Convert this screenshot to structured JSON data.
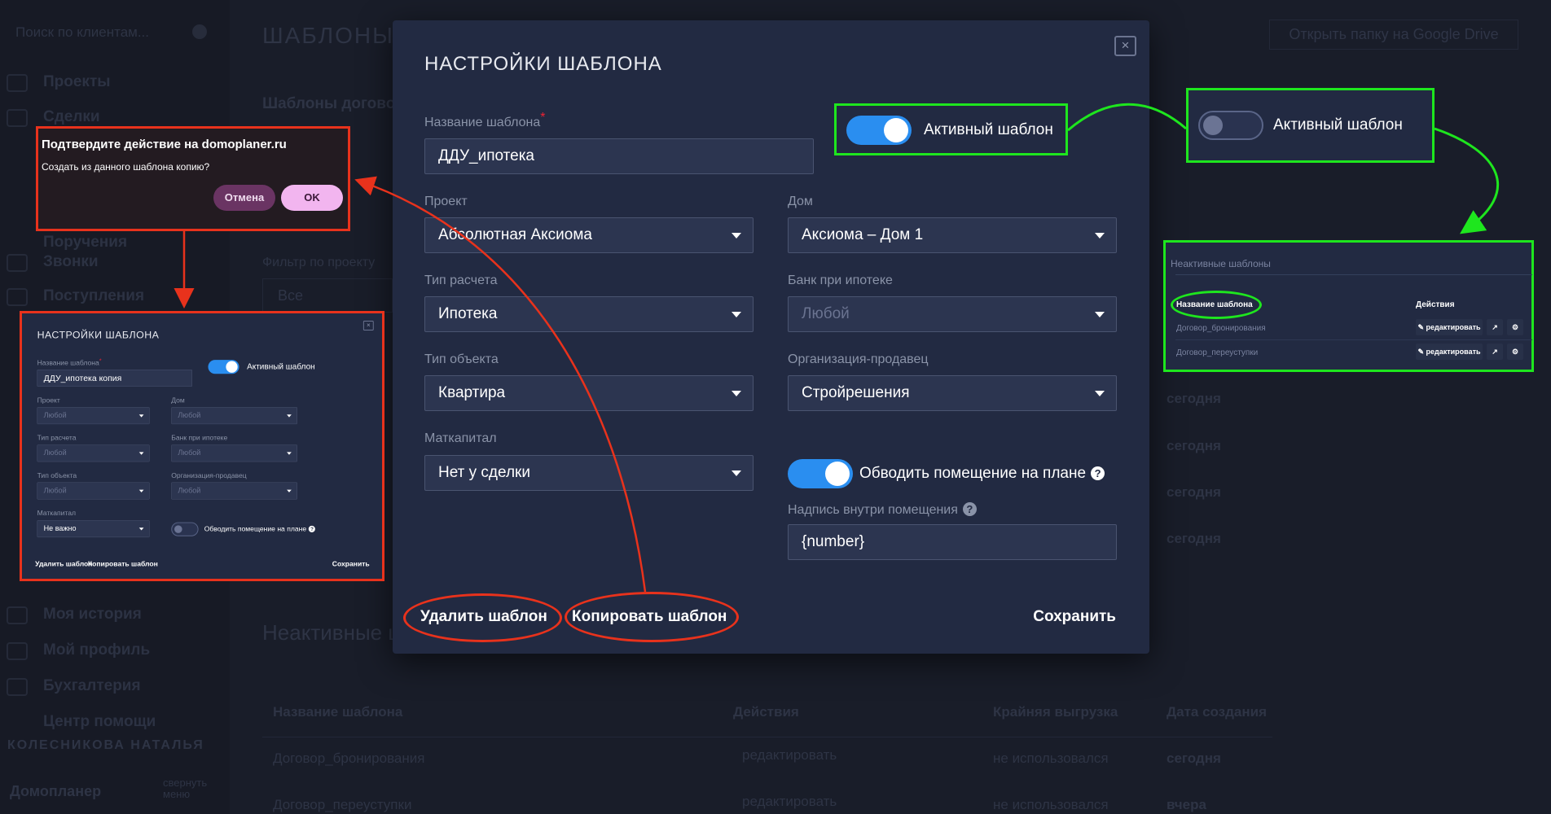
{
  "background": {
    "search_placeholder": "Поиск по клиентам...",
    "sidebar_items": [
      "Проекты",
      "Сделки",
      "Поручения",
      "Звонки",
      "Поступления",
      "Моя история",
      "Мой профиль",
      "Бухгалтерия",
      "Центр помощи"
    ],
    "user_name": "КОЛЕСНИКОВА НАТАЛЬЯ",
    "brand": "Домопланер",
    "collapse_menu": "свернуть меню",
    "page_title": "ШАБЛОНЫ",
    "section_title": "Шаблоны догово",
    "google_drive_button": "Открыть папку на Google Drive",
    "filter_label": "Фильтр по проекту",
    "filter_value": "Все",
    "inactive_heading": "Неактивные ш",
    "table_headers": [
      "Название шаблона",
      "Действия",
      "Крайняя выгрузка",
      "Дата создания"
    ],
    "rows": [
      {
        "name": "Договор_бронирования",
        "edit": "редактировать",
        "last_export": "не использовался",
        "created": "сегодня"
      },
      {
        "name": "Договор_переуступки",
        "edit": "редактировать",
        "last_export": "не использовался",
        "created": "вчера"
      }
    ],
    "dates_column": [
      "сегодня",
      "сегодня",
      "сегодня",
      "сегодня"
    ]
  },
  "modal": {
    "title": "НАСТРОЙКИ ШАБЛОНА",
    "close": "×",
    "name_label": "Название шаблона",
    "required_mark": "*",
    "name_value": "ДДУ_ипотека",
    "active_label": "Активный шаблон",
    "active": true,
    "fields": [
      {
        "label": "Проект",
        "value": "Абсолютная Аксиома",
        "placeholder": false
      },
      {
        "label": "Дом",
        "value": "Аксиома – Дом 1",
        "placeholder": false
      },
      {
        "label": "Тип расчета",
        "value": "Ипотека",
        "placeholder": false
      },
      {
        "label": "Банк при ипотеке",
        "value": "Любой",
        "placeholder": true
      },
      {
        "label": "Тип объекта",
        "value": "Квартира",
        "placeholder": false
      },
      {
        "label": "Организация-продавец",
        "value": "Стройрешения",
        "placeholder": false
      },
      {
        "label": "Маткапитал",
        "value": "Нет у сделки",
        "placeholder": false
      }
    ],
    "outline_label": "Обводить помещение на плане",
    "outline_on": true,
    "inscription_label": "Надпись внутри помещения",
    "inscription_value": "{number}",
    "delete_button": "Удалить шаблон",
    "copy_button": "Копировать шаблон",
    "save_button": "Сохранить"
  },
  "confirm": {
    "title": "Подтвердите действие на domoplaner.ru",
    "message": "Создать из данного шаблона копию?",
    "cancel": "Отмена",
    "ok": "OK"
  },
  "copy_modal": {
    "title": "НАСТРОЙКИ ШАБЛОНА",
    "name_value": "ДДУ_ипотека копия",
    "active_label": "Активный шаблон",
    "fields": [
      {
        "label": "Проект",
        "value": "Любой"
      },
      {
        "label": "Дом",
        "value": "Любой"
      },
      {
        "label": "Тип расчета",
        "value": "Любой"
      },
      {
        "label": "Банк при ипотеке",
        "value": "Любой"
      },
      {
        "label": "Тип объекта",
        "value": "Любой"
      },
      {
        "label": "Организация-продавец",
        "value": "Любой"
      },
      {
        "label": "Маткапитал",
        "value": "Не важно"
      }
    ],
    "outline_label": "Обводить помещение на плане",
    "delete_button": "Удалить шаблон",
    "copy_button": "Копировать шаблон",
    "save_button": "Сохранить"
  },
  "inactive_toggle": {
    "label": "Активный шаблон",
    "active": false
  },
  "inactive_table": {
    "title": "Неактивные шаблоны",
    "headers": [
      "Название шаблона",
      "Действия"
    ],
    "rows": [
      "Договор_бронирования",
      "Договор_переуступки"
    ],
    "edit": "редактировать"
  },
  "colors": {
    "annotation_red": "#e8321c",
    "annotation_green": "#1ee61e",
    "toggle_on": "#2a8ef0",
    "modal_bg": "#222a42"
  }
}
